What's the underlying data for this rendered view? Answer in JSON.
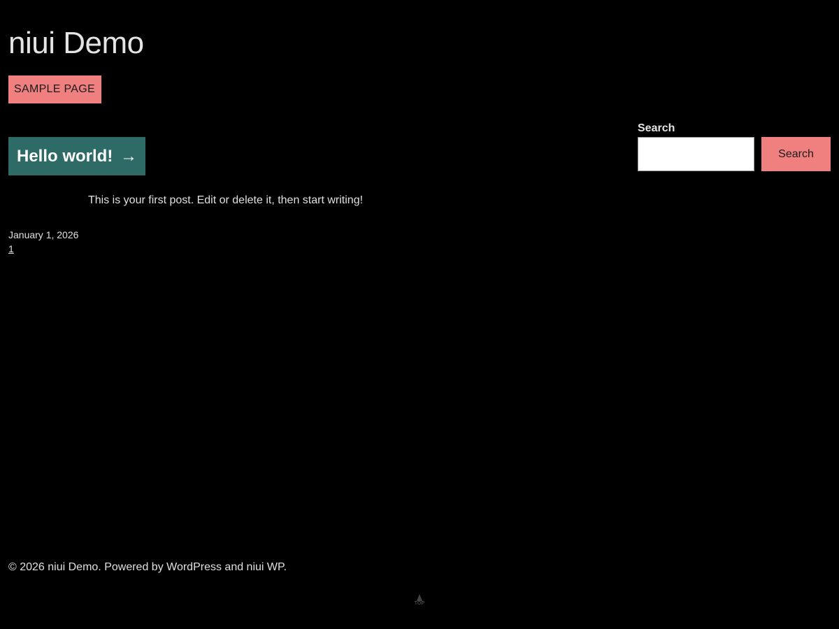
{
  "site": {
    "title": "niui Demo"
  },
  "nav": {
    "items": [
      {
        "label": "SAMPLE PAGE"
      }
    ]
  },
  "post": {
    "title": "Hello world!",
    "arrow": "→",
    "excerpt": "This is your first post. Edit or delete it, then start writing!",
    "date": "January 1, 2026"
  },
  "pagination": {
    "current": "1"
  },
  "search": {
    "label": "Search",
    "placeholder": "",
    "value": "",
    "button_label": "Search"
  },
  "footer": {
    "text": "© 2026 niui Demo. Powered by WordPress and niui WP.",
    "back_to_top_label": "TOP"
  },
  "colors": {
    "background": "#000000",
    "accent_pink": "#f08080",
    "post_title_bg": "#2e6b66",
    "text": "#e0e0e0"
  },
  "icons": {
    "back_to_top": "rocket-icon"
  }
}
